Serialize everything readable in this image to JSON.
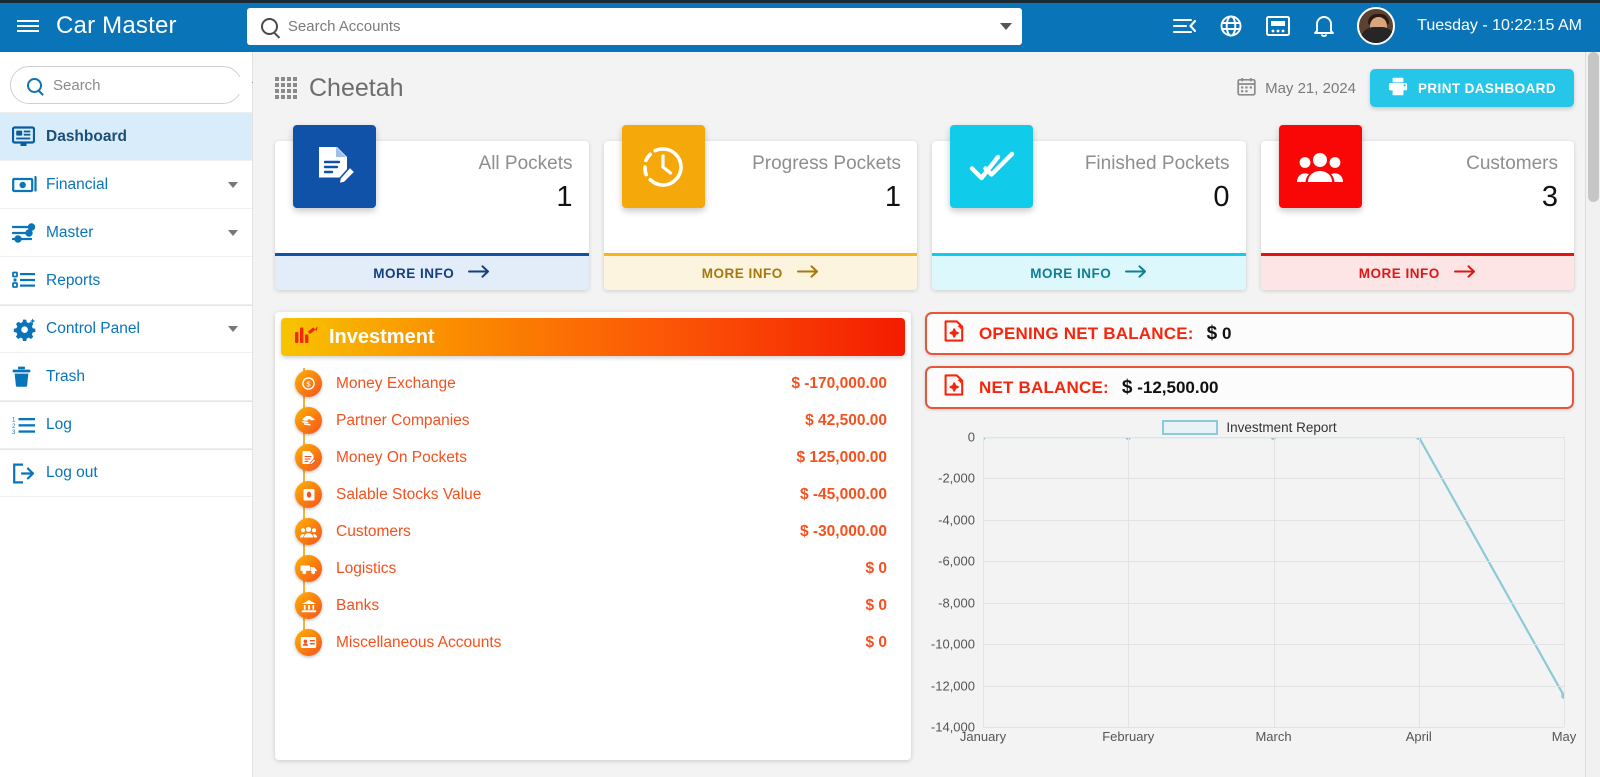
{
  "topbar": {
    "brand": "Car Master",
    "menu_icon": "hamburger-icon",
    "search_placeholder": "Search Accounts",
    "search_value": "",
    "icons": [
      "collapse-menu-icon",
      "globe-icon",
      "calculator-icon",
      "bell-icon"
    ],
    "datetime": "Tuesday - 10:22:15 AM"
  },
  "sidebar": {
    "search_placeholder": "Search",
    "search_value": "",
    "items": [
      {
        "label": "Dashboard",
        "icon": "monitor-icon",
        "active": true,
        "expandable": false
      },
      {
        "label": "Financial",
        "icon": "money-icon",
        "active": false,
        "expandable": true
      },
      {
        "label": "Master",
        "icon": "sliders-icon",
        "active": false,
        "expandable": true
      },
      {
        "label": "Reports",
        "icon": "list-icon",
        "active": false,
        "expandable": false
      },
      {
        "label": "Control Panel",
        "icon": "gear-sparkle-icon",
        "active": false,
        "expandable": true
      },
      {
        "label": "Trash",
        "icon": "trash-icon",
        "active": false,
        "expandable": false
      },
      {
        "label": "Log",
        "icon": "numbered-list-icon",
        "active": false,
        "expandable": false
      },
      {
        "label": "Log out",
        "icon": "logout-icon",
        "active": false,
        "expandable": false
      }
    ]
  },
  "page": {
    "title": "Cheetah",
    "title_icon": "grid-icon",
    "date": "May 21, 2024",
    "date_icon": "calendar-icon",
    "print_label": "PRINT DASHBOARD",
    "print_icon": "printer-icon"
  },
  "stat_cards": [
    {
      "title": "All Pockets",
      "value": "1",
      "more_info": "MORE INFO",
      "icon": "document-edit-icon",
      "color": "#1052a8",
      "foot_bg": "#e3edf9",
      "foot_text": "#13407e"
    },
    {
      "title": "Progress Pockets",
      "value": "1",
      "more_info": "MORE INFO",
      "icon": "clock-progress-icon",
      "color": "#f5a80a",
      "foot_bg": "#fdf4e0",
      "foot_text": "#a7770a"
    },
    {
      "title": "Finished Pockets",
      "value": "0",
      "more_info": "MORE INFO",
      "icon": "double-check-icon",
      "color": "#10ccea",
      "foot_bg": "#ddf8fd",
      "foot_text": "#0d7f92"
    },
    {
      "title": "Customers",
      "value": "3",
      "more_info": "MORE INFO",
      "icon": "people-icon",
      "color": "#f90606",
      "foot_bg": "#fde5e5",
      "foot_text": "#e11515"
    }
  ],
  "investment": {
    "header": "Investment",
    "header_icon": "bar-chart-arrow-icon",
    "rows": [
      {
        "name": "Money Exchange",
        "amount": "$ -170,000.00",
        "icon": "dollar-coin-icon"
      },
      {
        "name": "Partner Companies",
        "amount": "$ 42,500.00",
        "icon": "handshake-icon"
      },
      {
        "name": "Money On Pockets",
        "amount": "$ 125,000.00",
        "icon": "document-edit-icon"
      },
      {
        "name": "Salable Stocks Value",
        "amount": "$ -45,000.00",
        "icon": "box-icon"
      },
      {
        "name": "Customers",
        "amount": "$ -30,000.00",
        "icon": "people-icon"
      },
      {
        "name": "Logistics",
        "amount": "$ 0",
        "icon": "truck-icon"
      },
      {
        "name": "Banks",
        "amount": "$ 0",
        "icon": "bank-icon"
      },
      {
        "name": "Miscellaneous Accounts",
        "amount": "$ 0",
        "icon": "id-card-icon"
      }
    ]
  },
  "balances": [
    {
      "label": "OPENING NET BALANCE:",
      "currency": "$",
      "value": "0",
      "icon": "new-doc-sparkle-icon"
    },
    {
      "label": "NET BALANCE:",
      "currency": "$",
      "value": "-12,500.00",
      "icon": "new-doc-sparkle-icon"
    }
  ],
  "chart_data": {
    "type": "line",
    "title": "",
    "legend": [
      "Investment Report"
    ],
    "legend_position": "top-center",
    "series": [
      {
        "name": "Investment Report",
        "values": [
          0,
          0,
          0,
          0,
          -12500
        ]
      }
    ],
    "categories": [
      "January",
      "February",
      "March",
      "April",
      "May"
    ],
    "xlabel": "",
    "ylabel": "",
    "ylim": [
      -14000,
      0
    ],
    "yticks": [
      0,
      -2000,
      -4000,
      -6000,
      -8000,
      -10000,
      -12000,
      -14000
    ],
    "ytick_labels": [
      "0",
      "-2,000",
      "-4,000",
      "-6,000",
      "-8,000",
      "-10,000",
      "-12,000",
      "-14,000"
    ],
    "grid": true,
    "line_color": "#8ec9d8"
  },
  "theme": {
    "topbar_bg": "#0a74b8",
    "accent_blue": "#0a74b8",
    "orange": "#f4511e",
    "red": "#f3270d",
    "cyan": "#26c6e8"
  }
}
